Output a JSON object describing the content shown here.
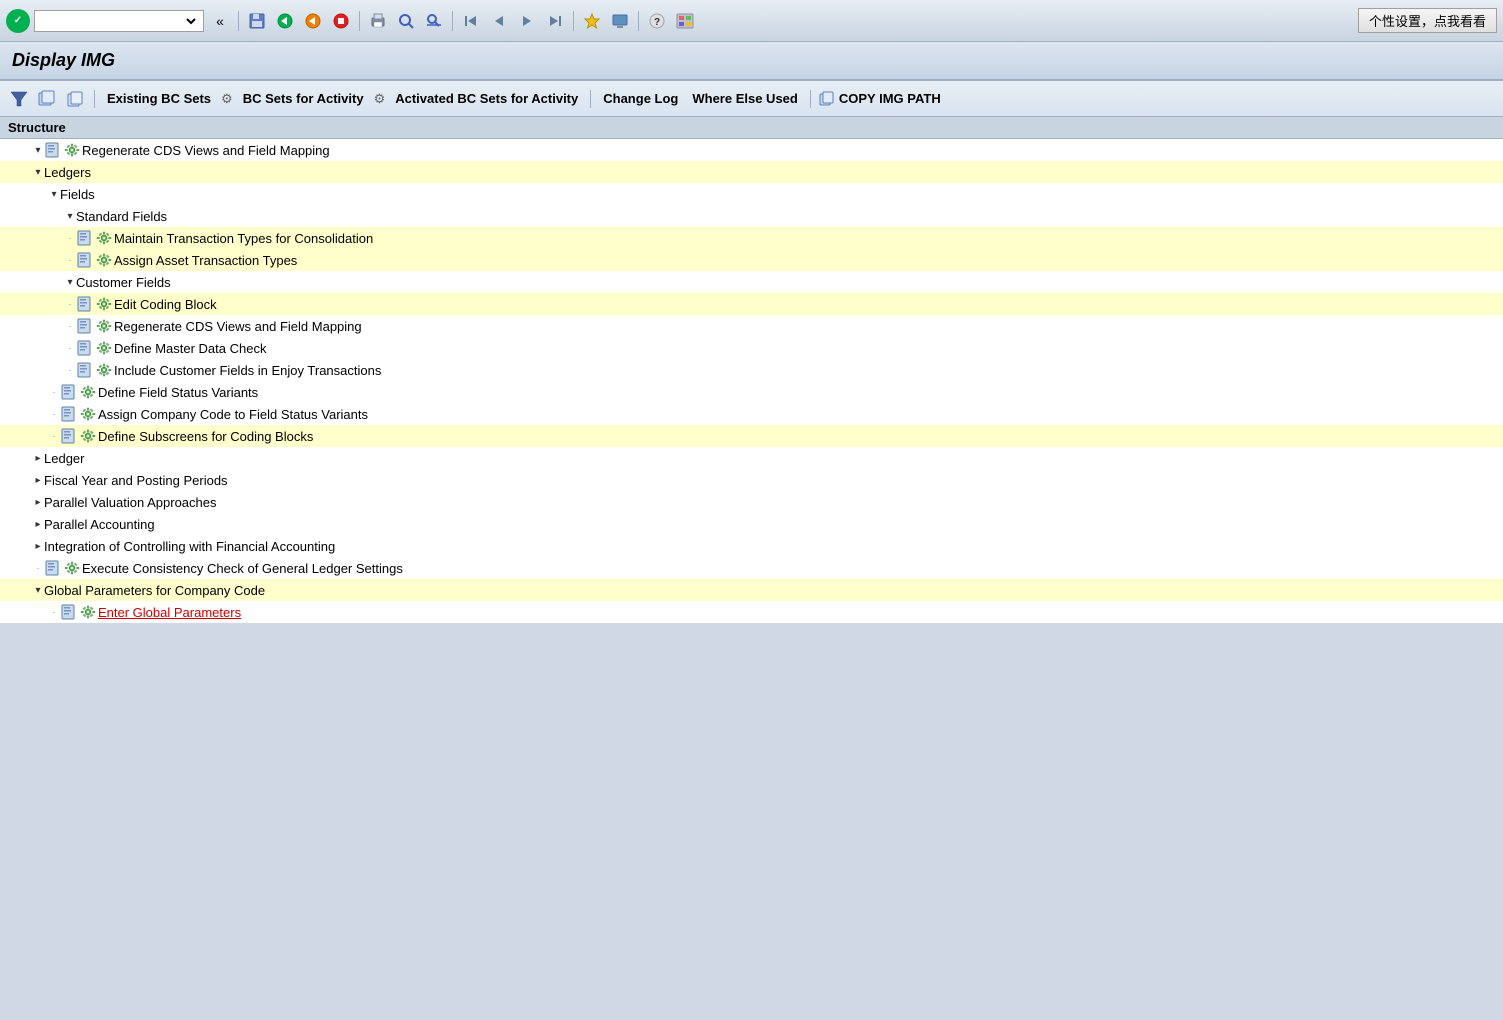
{
  "toolbar": {
    "personalize_label": "个性设置，点我看看",
    "back_label": "«"
  },
  "title": "Display IMG",
  "action_bar": {
    "existing_bc_sets": "Existing BC Sets",
    "bc_sets_activity": "BC Sets for Activity",
    "activated_bc_sets": "Activated BC Sets for Activity",
    "change_log": "Change Log",
    "where_else_used": "Where Else Used",
    "copy_img_path": "COPY IMG PATH"
  },
  "structure": {
    "header": "Structure",
    "rows": [
      {
        "id": 1,
        "indent": 2,
        "toggle": "▾",
        "dot": false,
        "has_doc": true,
        "has_gear": true,
        "highlighted": false,
        "label": "Regenerate CDS Views and Field Mapping",
        "red": false
      },
      {
        "id": 2,
        "indent": 2,
        "toggle": "▾",
        "dot": false,
        "has_doc": false,
        "has_gear": false,
        "highlighted": true,
        "label": "Ledgers",
        "red": false,
        "folder": true
      },
      {
        "id": 3,
        "indent": 3,
        "toggle": "▾",
        "dot": false,
        "has_doc": false,
        "has_gear": false,
        "highlighted": false,
        "label": "Fields",
        "red": false,
        "folder": true
      },
      {
        "id": 4,
        "indent": 4,
        "toggle": "▾",
        "dot": false,
        "has_doc": false,
        "has_gear": false,
        "highlighted": false,
        "label": "Standard Fields",
        "red": false,
        "folder": true
      },
      {
        "id": 5,
        "indent": 4,
        "toggle": null,
        "dot": true,
        "has_doc": true,
        "has_gear": true,
        "highlighted": true,
        "label": "Maintain Transaction Types for Consolidation",
        "red": false
      },
      {
        "id": 6,
        "indent": 4,
        "toggle": null,
        "dot": true,
        "has_doc": true,
        "has_gear": true,
        "highlighted": true,
        "label": "Assign Asset Transaction Types",
        "red": false
      },
      {
        "id": 7,
        "indent": 4,
        "toggle": "▾",
        "dot": false,
        "has_doc": false,
        "has_gear": false,
        "highlighted": false,
        "label": "Customer Fields",
        "red": false,
        "folder": true
      },
      {
        "id": 8,
        "indent": 4,
        "toggle": null,
        "dot": true,
        "has_doc": true,
        "has_gear": true,
        "highlighted": true,
        "label": "Edit Coding Block",
        "red": false
      },
      {
        "id": 9,
        "indent": 4,
        "toggle": null,
        "dot": true,
        "has_doc": true,
        "has_gear": true,
        "highlighted": false,
        "label": "Regenerate CDS Views and Field Mapping",
        "red": false
      },
      {
        "id": 10,
        "indent": 4,
        "toggle": null,
        "dot": true,
        "has_doc": true,
        "has_gear": true,
        "highlighted": false,
        "label": "Define Master Data Check",
        "red": false
      },
      {
        "id": 11,
        "indent": 4,
        "toggle": null,
        "dot": true,
        "has_doc": true,
        "has_gear": true,
        "highlighted": false,
        "label": "Include Customer Fields in Enjoy Transactions",
        "red": false
      },
      {
        "id": 12,
        "indent": 3,
        "toggle": null,
        "dot": true,
        "has_doc": true,
        "has_gear": true,
        "highlighted": false,
        "label": "Define Field Status Variants",
        "red": false
      },
      {
        "id": 13,
        "indent": 3,
        "toggle": null,
        "dot": true,
        "has_doc": true,
        "has_gear": true,
        "highlighted": false,
        "label": "Assign Company Code to Field Status Variants",
        "red": false
      },
      {
        "id": 14,
        "indent": 3,
        "toggle": null,
        "dot": true,
        "has_doc": true,
        "has_gear": true,
        "highlighted": true,
        "label": "Define Subscreens for Coding Blocks",
        "red": false
      },
      {
        "id": 15,
        "indent": 2,
        "toggle": "▸",
        "dot": false,
        "has_doc": false,
        "has_gear": false,
        "highlighted": false,
        "label": "Ledger",
        "red": false,
        "folder": true
      },
      {
        "id": 16,
        "indent": 2,
        "toggle": "▸",
        "dot": false,
        "has_doc": false,
        "has_gear": false,
        "highlighted": false,
        "label": "Fiscal Year and Posting Periods",
        "red": false,
        "folder": true
      },
      {
        "id": 17,
        "indent": 2,
        "toggle": "▸",
        "dot": false,
        "has_doc": false,
        "has_gear": false,
        "highlighted": false,
        "label": "Parallel Valuation Approaches",
        "red": false,
        "folder": true
      },
      {
        "id": 18,
        "indent": 2,
        "toggle": "▸",
        "dot": false,
        "has_doc": false,
        "has_gear": false,
        "highlighted": false,
        "label": "Parallel Accounting",
        "red": false,
        "folder": true
      },
      {
        "id": 19,
        "indent": 2,
        "toggle": "▸",
        "dot": false,
        "has_doc": false,
        "has_gear": false,
        "highlighted": false,
        "label": "Integration of Controlling with Financial Accounting",
        "red": false,
        "folder": true
      },
      {
        "id": 20,
        "indent": 2,
        "toggle": null,
        "dot": true,
        "has_doc": true,
        "has_gear": true,
        "highlighted": false,
        "label": "Execute Consistency Check of General Ledger Settings",
        "red": false
      },
      {
        "id": 21,
        "indent": 2,
        "toggle": "▾",
        "dot": false,
        "has_doc": false,
        "has_gear": false,
        "highlighted": true,
        "label": "Global Parameters for Company Code",
        "red": false,
        "folder": true
      },
      {
        "id": 22,
        "indent": 3,
        "toggle": null,
        "dot": true,
        "has_doc": true,
        "has_gear": true,
        "highlighted": false,
        "label": "Enter Global Parameters",
        "red": true
      }
    ]
  }
}
